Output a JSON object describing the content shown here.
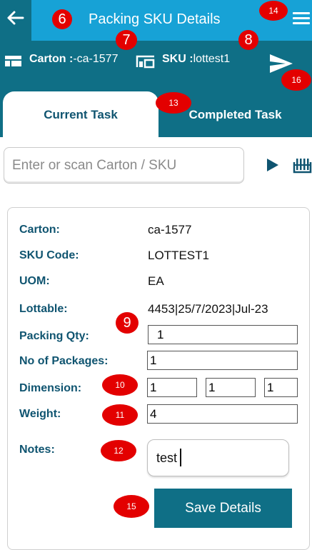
{
  "header": {
    "title": "Packing SKU Details",
    "back_icon": "back-arrow-icon",
    "menu_icon": "hamburger-menu-icon",
    "bg_color": "#0f6f86",
    "title_bg_color": "#17a2d6"
  },
  "infobar": {
    "carton_label": "Carton :",
    "carton_value": "-ca-1577",
    "carton_icon": "carton-icon",
    "sku_label": "SKU :",
    "sku_value": "lottest1",
    "sku_icon": "sku-icon",
    "send_icon": "send-icon"
  },
  "tabs": [
    {
      "label": "Current Task",
      "active": true
    },
    {
      "label": "Completed Task",
      "active": false
    }
  ],
  "search": {
    "placeholder": "Enter or scan Carton / SKU",
    "go_icon": "play-icon",
    "scan_icon": "barcode-icon"
  },
  "details": {
    "carton_label": "Carton:",
    "carton_value": "ca-1577",
    "sku_label": "SKU Code:",
    "sku_value": "LOTTEST1",
    "uom_label": "UOM:",
    "uom_value": "EA",
    "lottable_label": "Lottable:",
    "lottable_value": "4453|25/7/2023|Jul-23",
    "packing_qty_label": "Packing Qty:",
    "packing_qty_value": "1",
    "packages_label": "No of Packages:",
    "packages_value": "1",
    "dimension_label": "Dimension:",
    "dimension_values": [
      "1",
      "1",
      "1"
    ],
    "weight_label": "Weight:",
    "weight_value": "4",
    "notes_label": "Notes:",
    "notes_value": "test"
  },
  "save_button": {
    "label": "Save Details"
  },
  "markers": {
    "m6": "6",
    "m7": "7",
    "m8": "8",
    "m9": "9",
    "m10": "10",
    "m11": "11",
    "m12": "12",
    "m13": "13",
    "m14": "14",
    "m15": "15",
    "m16": "16",
    "color": "#e30000"
  }
}
